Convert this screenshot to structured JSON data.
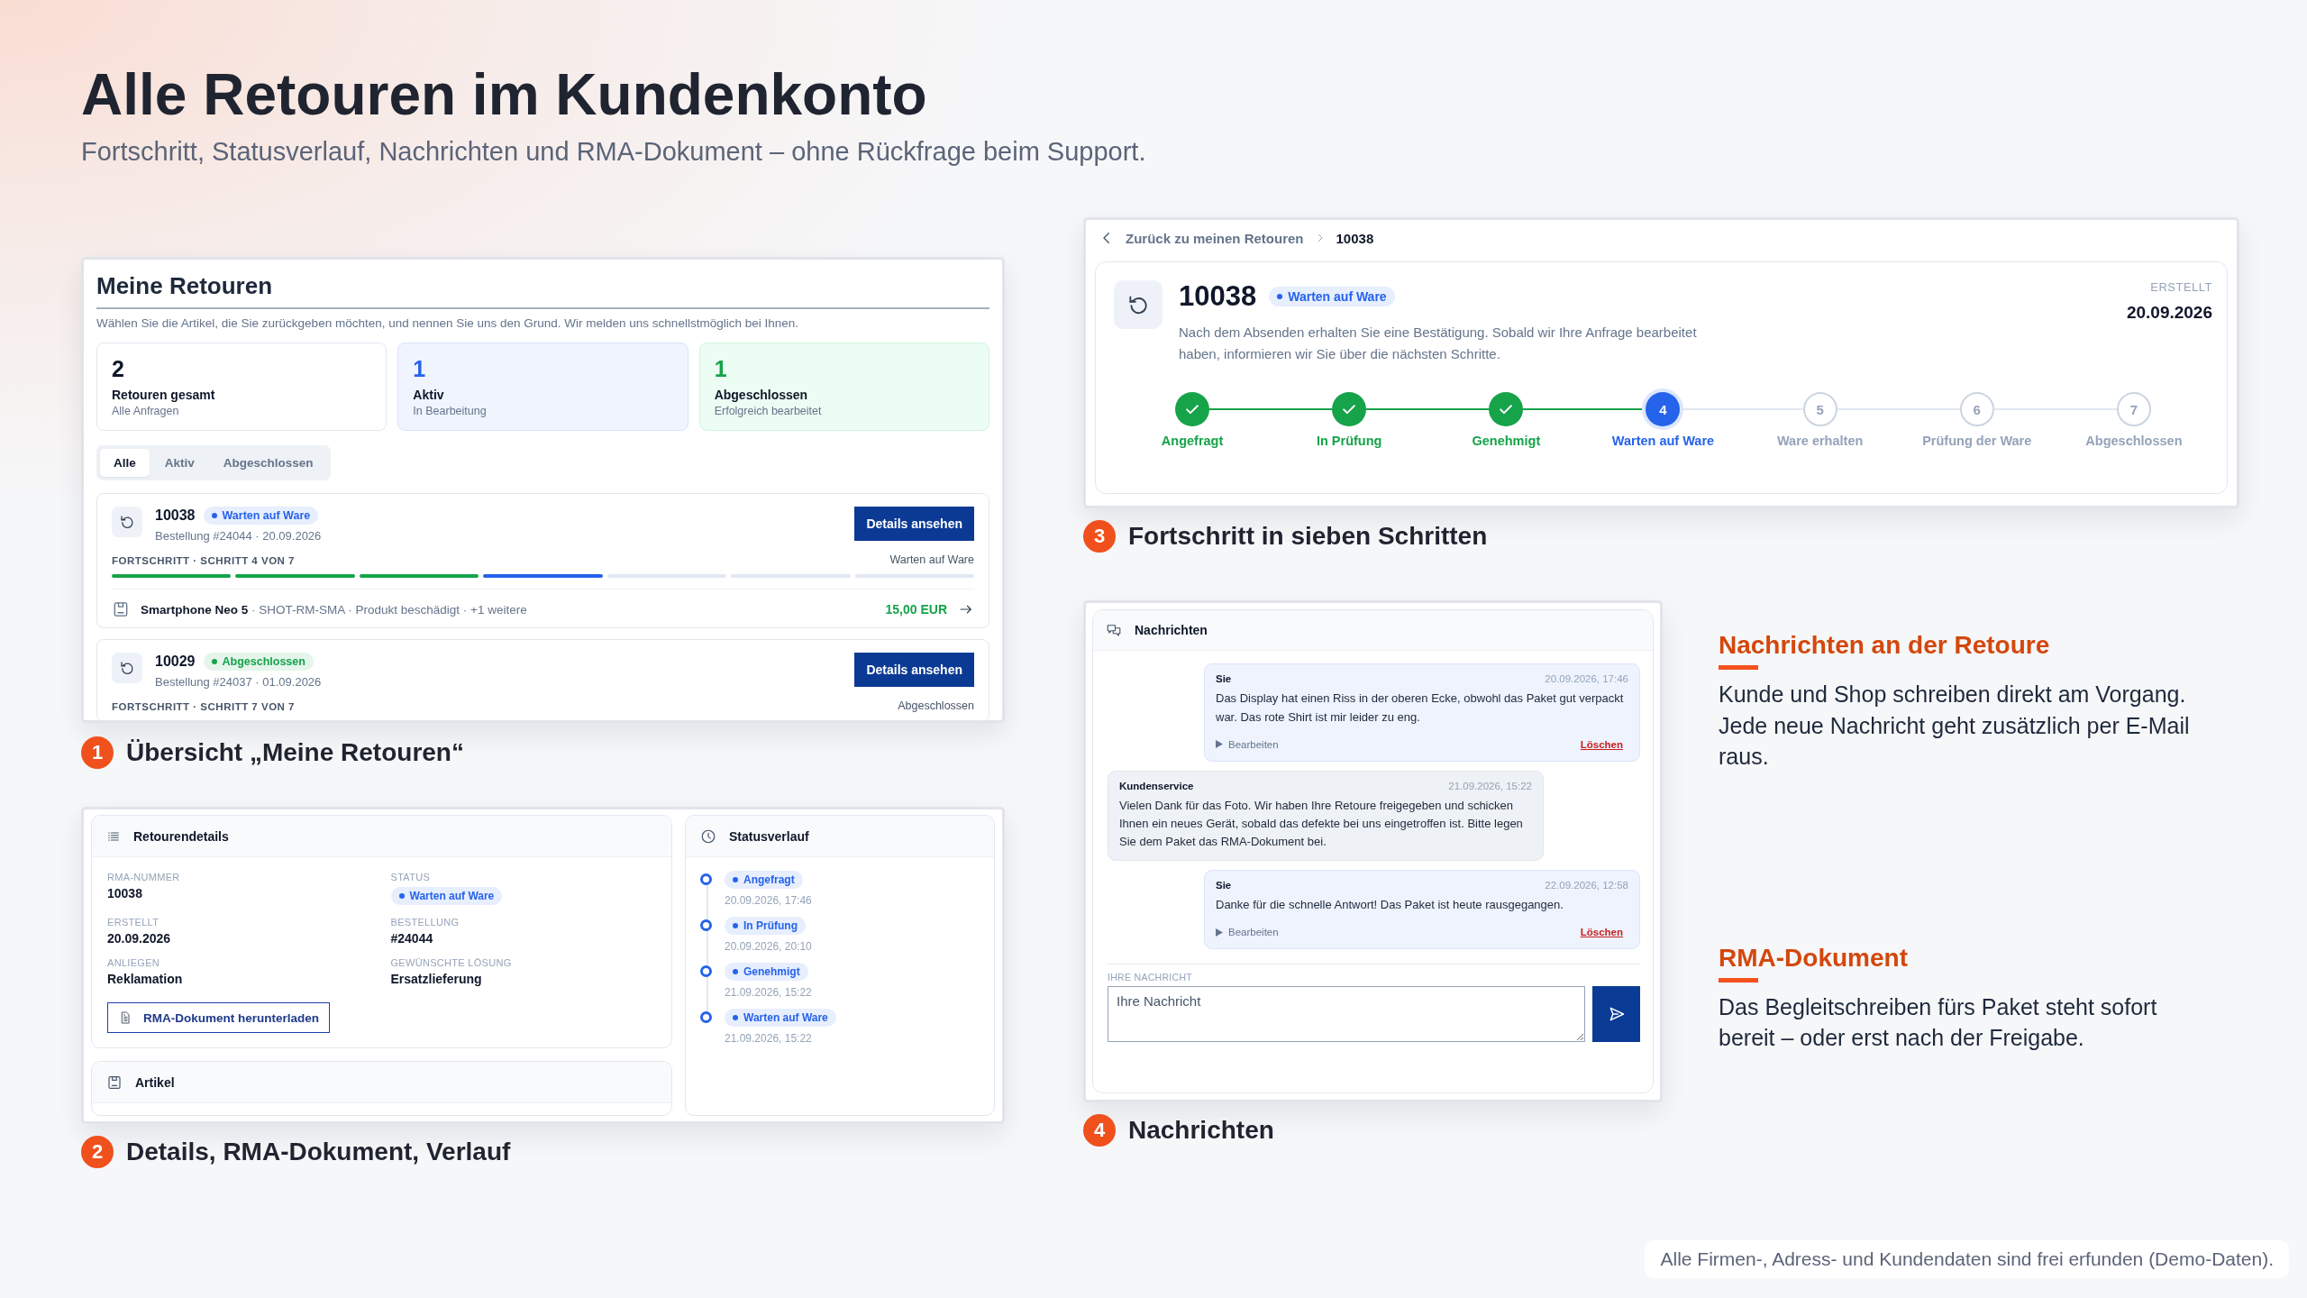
{
  "page": {
    "title": "Alle Retouren im Kundenkonto",
    "subtitle": "Fortschritt, Statusverlauf, Nachrichten und RMA-Dokument – ohne Rückfrage beim Support."
  },
  "overview": {
    "caption": {
      "number": "1",
      "text": "Übersicht „Meine Retouren“"
    },
    "title": "Meine Retouren",
    "description": "Wählen Sie die Artikel, die Sie zurückgeben möchten, und nennen Sie uns den Grund. Wir melden uns schnellstmöglich bei Ihnen.",
    "stats": [
      {
        "kind": "total",
        "value": "2",
        "label": "Retouren gesamt",
        "sublabel": "Alle Anfragen"
      },
      {
        "kind": "active",
        "value": "1",
        "label": "Aktiv",
        "sublabel": "In Bearbeitung"
      },
      {
        "kind": "done",
        "value": "1",
        "label": "Abgeschlossen",
        "sublabel": "Erfolgreich bearbeitet"
      }
    ],
    "filter_tabs": [
      {
        "label": "Alle",
        "selected": true
      },
      {
        "label": "Aktiv",
        "selected": false
      },
      {
        "label": "Abgeschlossen",
        "selected": false
      }
    ],
    "returns": [
      {
        "number": "10038",
        "status": {
          "label": "Warten auf Ware",
          "color": "#2563eb"
        },
        "meta": "Bestellung #24044 · 20.09.2026",
        "button": "Details ansehen",
        "progress_label": "FORTSCHRITT · SCHRITT 4 VON 7",
        "progress_status": "Warten auf Ware",
        "segments": [
          {
            "done": true,
            "current": false
          },
          {
            "done": true,
            "current": false
          },
          {
            "done": true,
            "current": false
          },
          {
            "done": false,
            "current": true
          },
          {
            "done": false,
            "current": false
          },
          {
            "done": false,
            "current": false
          },
          {
            "done": false,
            "current": false
          }
        ],
        "item": {
          "summary": "**Smartphone Neo 5** · SHOT-RM-SMA · Produkt beschädigt · +1 weitere",
          "amount": "15,00 EUR"
        }
      },
      {
        "number": "10029",
        "status": {
          "label": "Abgeschlossen",
          "color": "#16a34a"
        },
        "meta": "Bestellung #24037 · 01.09.2026",
        "button": "Details ansehen",
        "progress_label": "FORTSCHRITT · SCHRITT 7 VON 7",
        "progress_status": "Abgeschlossen"
      }
    ]
  },
  "details": {
    "caption": {
      "number": "2",
      "text": "Details, RMA-Dokument, Verlauf"
    },
    "title": "Retourendetails",
    "fields": [
      {
        "label": "RMA-NUMMER",
        "value": "10038"
      },
      {
        "label": "STATUS",
        "status": {
          "label": "Warten auf Ware",
          "color": "#2563eb"
        }
      },
      {
        "label": "ERSTELLT",
        "value": "20.09.2026"
      },
      {
        "label": "BESTELLUNG",
        "value": "#24044"
      },
      {
        "label": "ANLIEGEN",
        "value": "Reklamation"
      },
      {
        "label": "GEWÜNSCHTE LÖSUNG",
        "value": "Ersatzlieferung"
      }
    ],
    "download_button": "RMA-Dokument herunterladen",
    "articles_title": "Artikel",
    "history_title": "Statusverlauf",
    "history": [
      {
        "status": "Angefragt",
        "time": "20.09.2026, 17:46"
      },
      {
        "status": "In Prüfung",
        "time": "20.09.2026, 20:10"
      },
      {
        "status": "Genehmigt",
        "time": "21.09.2026, 15:22"
      },
      {
        "status": "Warten auf Ware",
        "time": "21.09.2026, 15:22"
      }
    ]
  },
  "progress": {
    "caption": {
      "number": "3",
      "text": "Fortschritt in sieben Schritten"
    },
    "back_link": "Zurück zu meinen Retouren",
    "breadcrumb_current": "10038",
    "number": "10038",
    "status": {
      "label": "Warten auf Ware",
      "color": "#2563eb"
    },
    "description": "Nach dem Absenden erhalten Sie eine Bestätigung. Sobald wir Ihre Anfrage bearbeitet haben, informieren wir Sie über die nächsten Schritte.",
    "created_label": "ERSTELLT",
    "created": "20.09.2026",
    "steps": [
      {
        "label": "Angefragt",
        "done": true,
        "current": false
      },
      {
        "label": "In Prüfung",
        "done": true,
        "current": false
      },
      {
        "label": "Genehmigt",
        "done": true,
        "current": false
      },
      {
        "label": "Warten auf Ware",
        "number": "4",
        "done": false,
        "current": true
      },
      {
        "label": "Ware erhalten",
        "number": "5",
        "done": false,
        "current": false
      },
      {
        "label": "Prüfung der Ware",
        "number": "6",
        "done": false,
        "current": false
      },
      {
        "label": "Abgeschlossen",
        "number": "7",
        "done": false,
        "current": false
      }
    ]
  },
  "messages": {
    "caption": {
      "number": "4",
      "text": "Nachrichten"
    },
    "title": "Nachrichten",
    "items": [
      {
        "author": "Sie",
        "time": "20.09.2026, 17:46",
        "text": "Das Display hat einen Riss in der oberen Ecke, obwohl das Paket gut verpackt war. Das rote Shirt ist mir leider zu eng.",
        "own": true,
        "edit": "Bearbeiten",
        "delete": "Löschen"
      },
      {
        "author": "Kundenservice",
        "time": "21.09.2026, 15:22",
        "text": "Vielen Dank für das Foto. Wir haben Ihre Retoure freigegeben und schicken Ihnen ein neues Gerät, sobald das defekte bei uns eingetroffen ist. Bitte legen Sie dem Paket das RMA-Dokument bei.",
        "own": false
      },
      {
        "author": "Sie",
        "time": "22.09.2026, 12:58",
        "text": "Danke für die schnelle Antwort! Das Paket ist heute rausgegangen.",
        "own": true,
        "edit": "Bearbeiten",
        "delete": "Löschen"
      }
    ],
    "input_label": "IHRE NACHRICHT",
    "placeholder": "Ihre Nachricht"
  },
  "notes": [
    {
      "title": "Nachrichten an der Retoure",
      "text": "Kunde und Shop schreiben direkt am Vorgang. Jede neue Nachricht geht zusätzlich per E-Mail raus."
    },
    {
      "title": "RMA-Dokument",
      "text": "Das Begleitschreiben fürs Paket steht sofort bereit – oder erst nach der Freigabe."
    }
  ],
  "footer": "Alle Firmen-, Adress- und Kundendaten sind frei erfunden (Demo-Daten)."
}
